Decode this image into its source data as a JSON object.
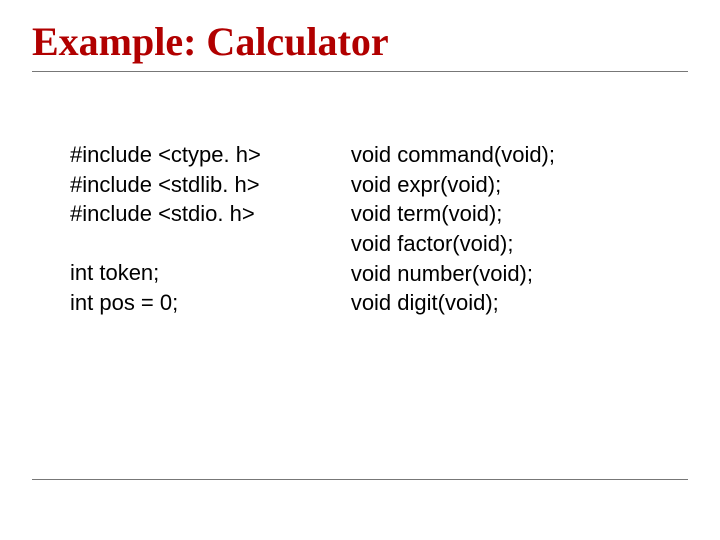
{
  "title": "Example: Calculator",
  "left": {
    "l1": "#include <ctype. h>",
    "l2": "#include <stdlib. h>",
    "l3": "#include <stdio. h>",
    "l4": "int token;",
    "l5": "int pos = 0;"
  },
  "right": {
    "r1": "void command(void);",
    "r2": "void expr(void);",
    "r3": "void term(void);",
    "r4": "void factor(void);",
    "r5": "void number(void);",
    "r6": "void digit(void);"
  }
}
